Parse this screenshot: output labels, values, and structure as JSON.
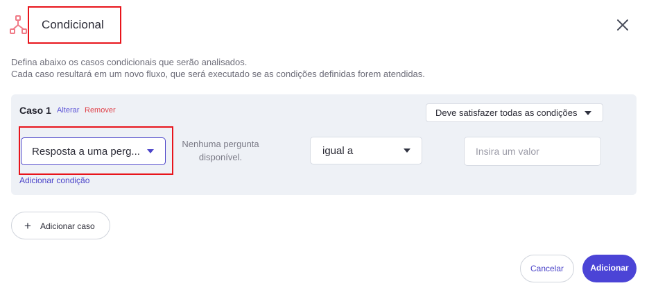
{
  "header": {
    "title": "Condicional",
    "icon": "branch-icon",
    "close_icon": "close-icon"
  },
  "description": {
    "line1": "Defina abaixo os casos condicionais que serão analisados.",
    "line2": "Cada caso resultará em um novo fluxo, que será executado se as condições definidas forem atendidas."
  },
  "case": {
    "title": "Caso 1",
    "alterar_label": "Alterar",
    "remover_label": "Remover",
    "match_selected": "Deve satisfazer todas as condições",
    "condition": {
      "question_selected": "Resposta a uma perg...",
      "no_question_line1": "Nenhuma pergunta",
      "no_question_line2": "disponível.",
      "operator_selected": "igual a",
      "value": "",
      "value_placeholder": "Insira um valor"
    },
    "add_condition_label": "Adicionar condição"
  },
  "actions": {
    "add_case_label": "Adicionar caso",
    "cancel_label": "Cancelar",
    "add_label": "Adicionar"
  },
  "colors": {
    "accent": "#4b44d6",
    "danger": "#e0424a",
    "icon": "#f07a86",
    "panel": "#eef1f6",
    "highlight": "#e8141b"
  }
}
